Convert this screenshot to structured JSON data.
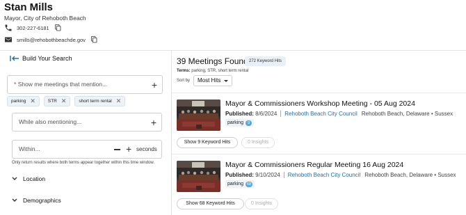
{
  "profile": {
    "name": "Stan Mills",
    "title": "Mayor, City of Rehoboth Beach",
    "phone": "302-227-6181",
    "email": "smills@rehobothbeachde.gov"
  },
  "search": {
    "back_label": "Build Your Search",
    "mention_placeholder": "Show me meetings that mention...",
    "chips": [
      "parking",
      "STR",
      "short term rental"
    ],
    "also_placeholder": "While also mentioning...",
    "within_placeholder": "Within...",
    "within_unit": "seconds",
    "within_note": "Only return results where both terms appear together within this time window.",
    "location_label": "Location",
    "demographics_label": "Demographics"
  },
  "results": {
    "found_label": "39 Meetings Found",
    "keyword_hits_badge": "272 Keyword Hits",
    "terms_label": "Terms:",
    "terms_value": "parking, STR, short term rental",
    "sort_label": "Sort by",
    "sort_value": "Most Hits",
    "meetings": [
      {
        "title": "Mayor & Commissioners Workshop Meeting - 05 Aug 2024",
        "published_label": "Published:",
        "published_date": "8/6/2024",
        "org": "Rehoboth Beach City Council",
        "location": "Rehoboth Beach, Delaware • Sussex",
        "hit_term": "parking",
        "hit_count": "9",
        "keyword_button": "Show 9 Keyword Hits",
        "insights_button": "0 Insights"
      },
      {
        "title": "Mayor & Commissioners Regular Meeting 16 Aug 2024",
        "published_label": "Published:",
        "published_date": "9/10/2024",
        "org": "Rehoboth Beach City Council",
        "location": "Rehoboth Beach, Delaware • Sussex",
        "hit_term": "parking",
        "hit_count": "68",
        "keyword_button": "Show 68 Keyword Hits",
        "insights_button": "0 Insights"
      }
    ]
  },
  "colors": {
    "link": "#1f6fa8",
    "count_badge": "#5aa7dc",
    "chip_bg": "#eef3fa",
    "required": "#c0392b"
  }
}
